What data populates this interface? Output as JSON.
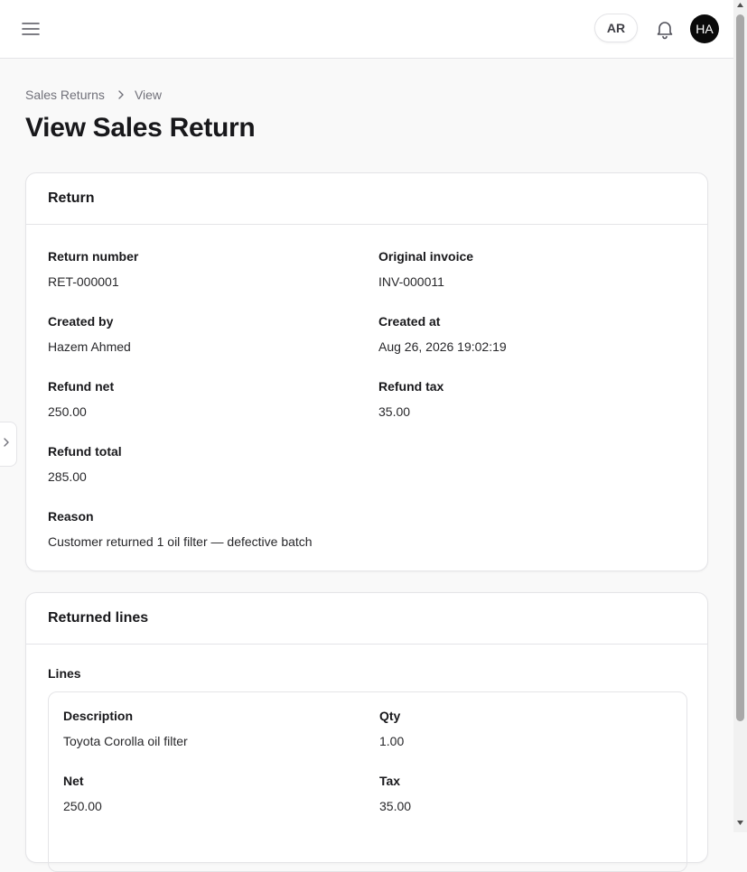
{
  "topbar": {
    "menu_icon": "hamburger-menu-icon",
    "language_label": "AR",
    "notification_icon": "bell-icon",
    "avatar_initials": "HA"
  },
  "breadcrumb": {
    "items": [
      "Sales Returns",
      "View"
    ],
    "separator_icon": "chevron-right-icon"
  },
  "page": {
    "title": "View Sales Return"
  },
  "return_card": {
    "title": "Return",
    "fields": {
      "return_number": {
        "label": "Return number",
        "value": "RET-000001"
      },
      "original_invoice": {
        "label": "Original invoice",
        "value": "INV-000011"
      },
      "created_by": {
        "label": "Created by",
        "value": "Hazem Ahmed"
      },
      "created_at": {
        "label": "Created at",
        "value": "Aug 26, 2026 19:02:19"
      },
      "refund_net": {
        "label": "Refund net",
        "value": "250.00"
      },
      "refund_tax": {
        "label": "Refund tax",
        "value": "35.00"
      },
      "refund_total": {
        "label": "Refund total",
        "value": "285.00"
      },
      "reason": {
        "label": "Reason",
        "value": "Customer returned 1 oil filter — defective batch"
      }
    }
  },
  "lines_card": {
    "title": "Returned lines",
    "lines_label": "Lines",
    "lines": [
      {
        "description_label": "Description",
        "description": "Toyota Corolla oil filter",
        "qty_label": "Qty",
        "qty": "1.00",
        "net_label": "Net",
        "net": "250.00",
        "tax_label": "Tax",
        "tax": "35.00"
      }
    ]
  },
  "colors": {
    "accent": "#0a0a0a",
    "border": "#e4e4e7",
    "background": "#f9f9f9",
    "muted_text": "#71717a"
  }
}
